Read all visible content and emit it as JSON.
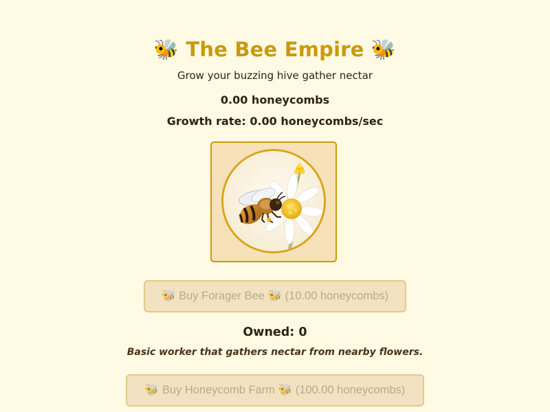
{
  "header": {
    "title_icon": "🐝",
    "title": "The Bee Empire",
    "subtitle": "Grow your buzzing hive gather nectar"
  },
  "stats": {
    "honeycombs": "0.00 honeycombs",
    "growth_rate": "Growth rate: 0.00 honeycombs/sec"
  },
  "clicker": {
    "icon": "bee-on-flower"
  },
  "upgrades": [
    {
      "icon": "🐝",
      "label": "Buy Forager Bee",
      "cost": "(10.00 honeycombs)",
      "owned": "Owned: 0",
      "description": "Basic worker that gathers nectar from nearby flowers.",
      "enabled": false
    },
    {
      "icon": "🐝",
      "label": "Buy Honeycomb Farm",
      "cost": "(100.00 honeycombs)",
      "enabled": false
    }
  ],
  "colors": {
    "background": "#fffae3",
    "title": "#c99a0d",
    "accent_border": "#c99a0d",
    "button_disabled_bg": "#f3e2c0",
    "button_disabled_text": "#b9a98c"
  }
}
